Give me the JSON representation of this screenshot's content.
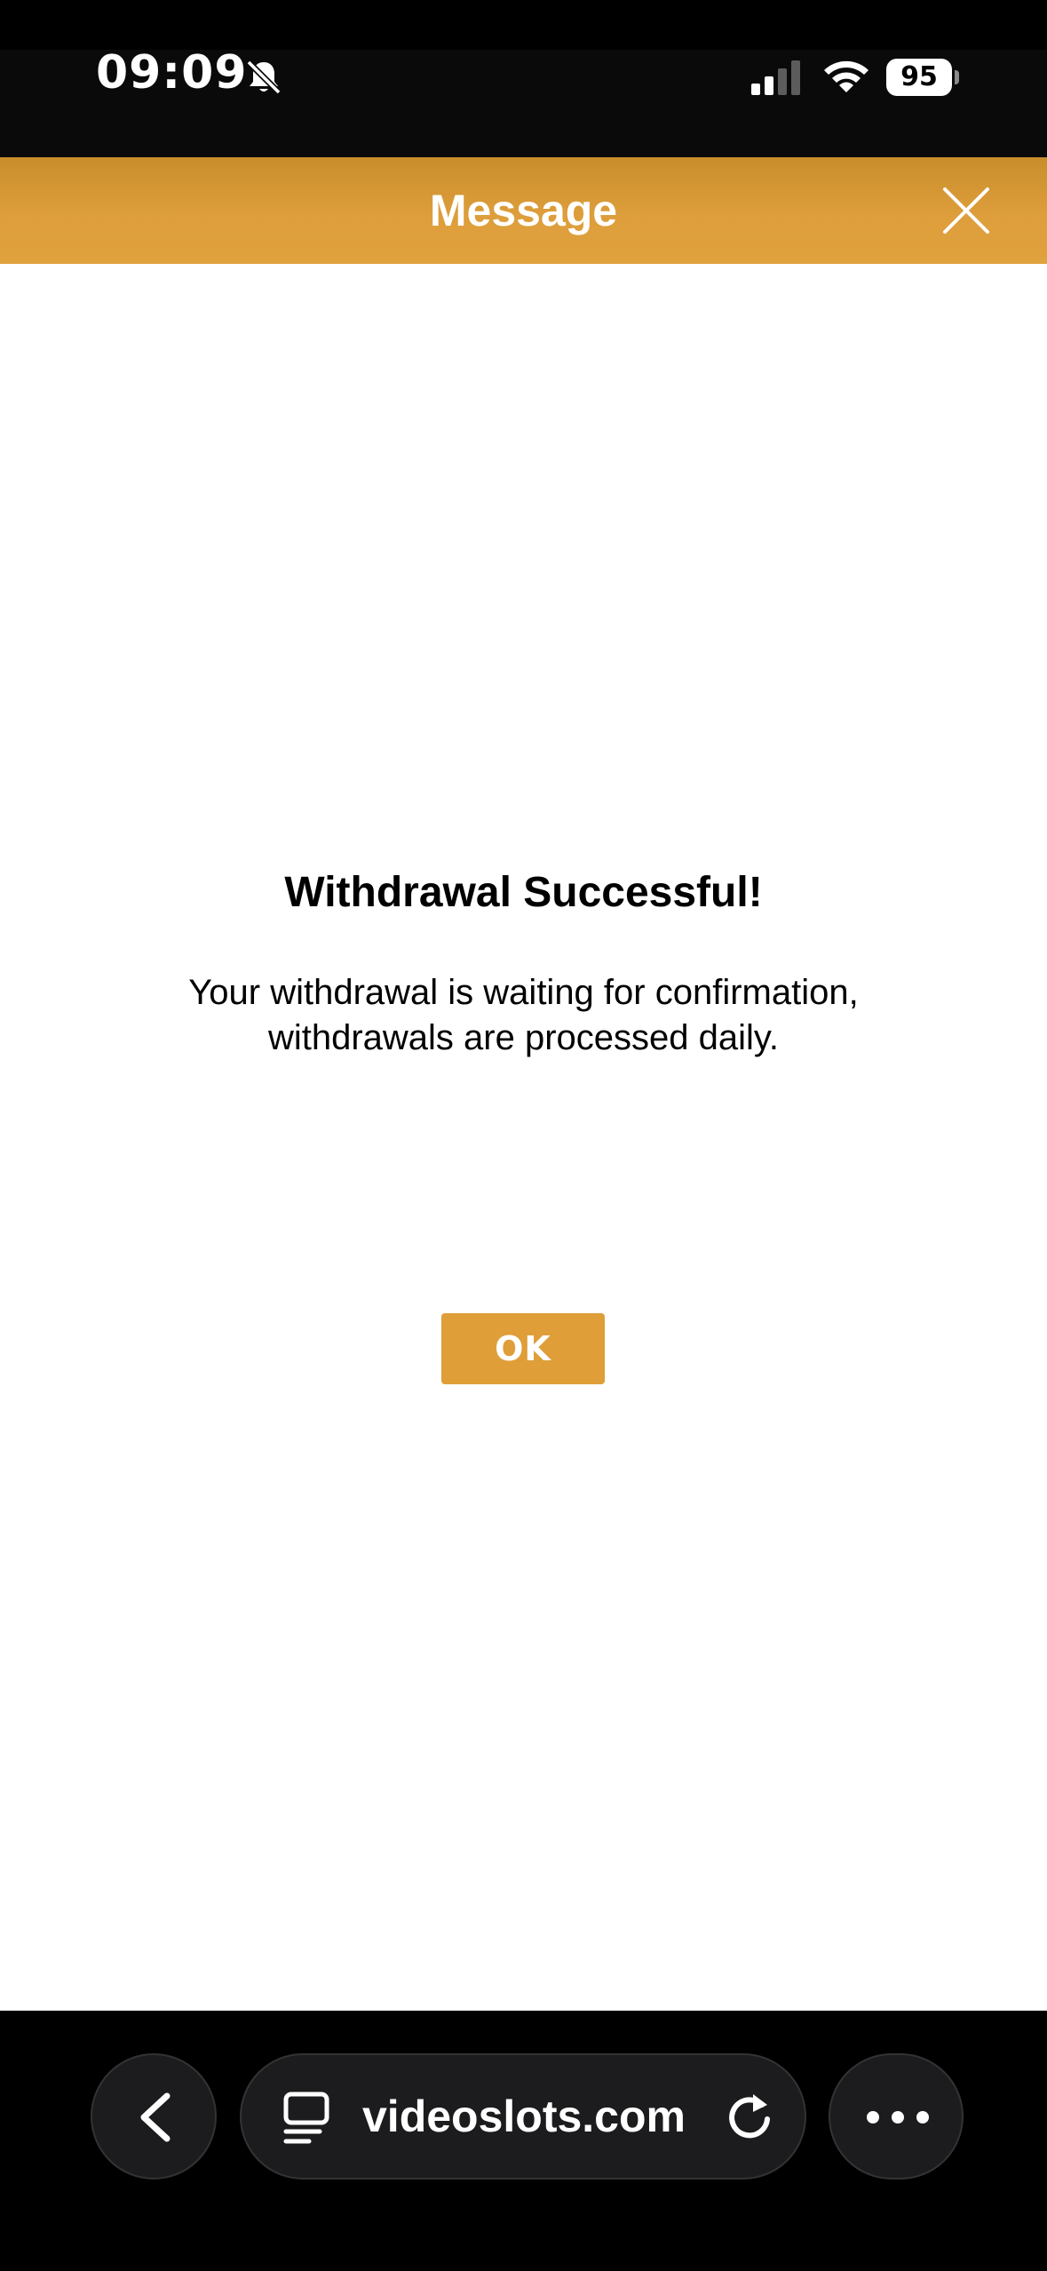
{
  "status_bar": {
    "time": "09:09",
    "battery_percent": "95",
    "icons": [
      "bell-off-icon",
      "cellular-signal-icon",
      "wifi-icon",
      "battery-icon"
    ]
  },
  "header": {
    "title": "Message",
    "close_icon": "close-icon"
  },
  "message": {
    "title": "Withdrawal Successful!",
    "body_line1": "Your withdrawal is waiting for confirmation,",
    "body_line2": "withdrawals are processed daily.",
    "ok_label": "OK"
  },
  "browser_bar": {
    "url": "videoslots.com",
    "icons": [
      "chevron-left-icon",
      "tab-icon",
      "reload-icon",
      "more-icon"
    ]
  },
  "colors": {
    "accent": "#df9e38",
    "header_dark": "#c98e2c",
    "background": "#ffffff",
    "browser_bar": "#000000"
  }
}
